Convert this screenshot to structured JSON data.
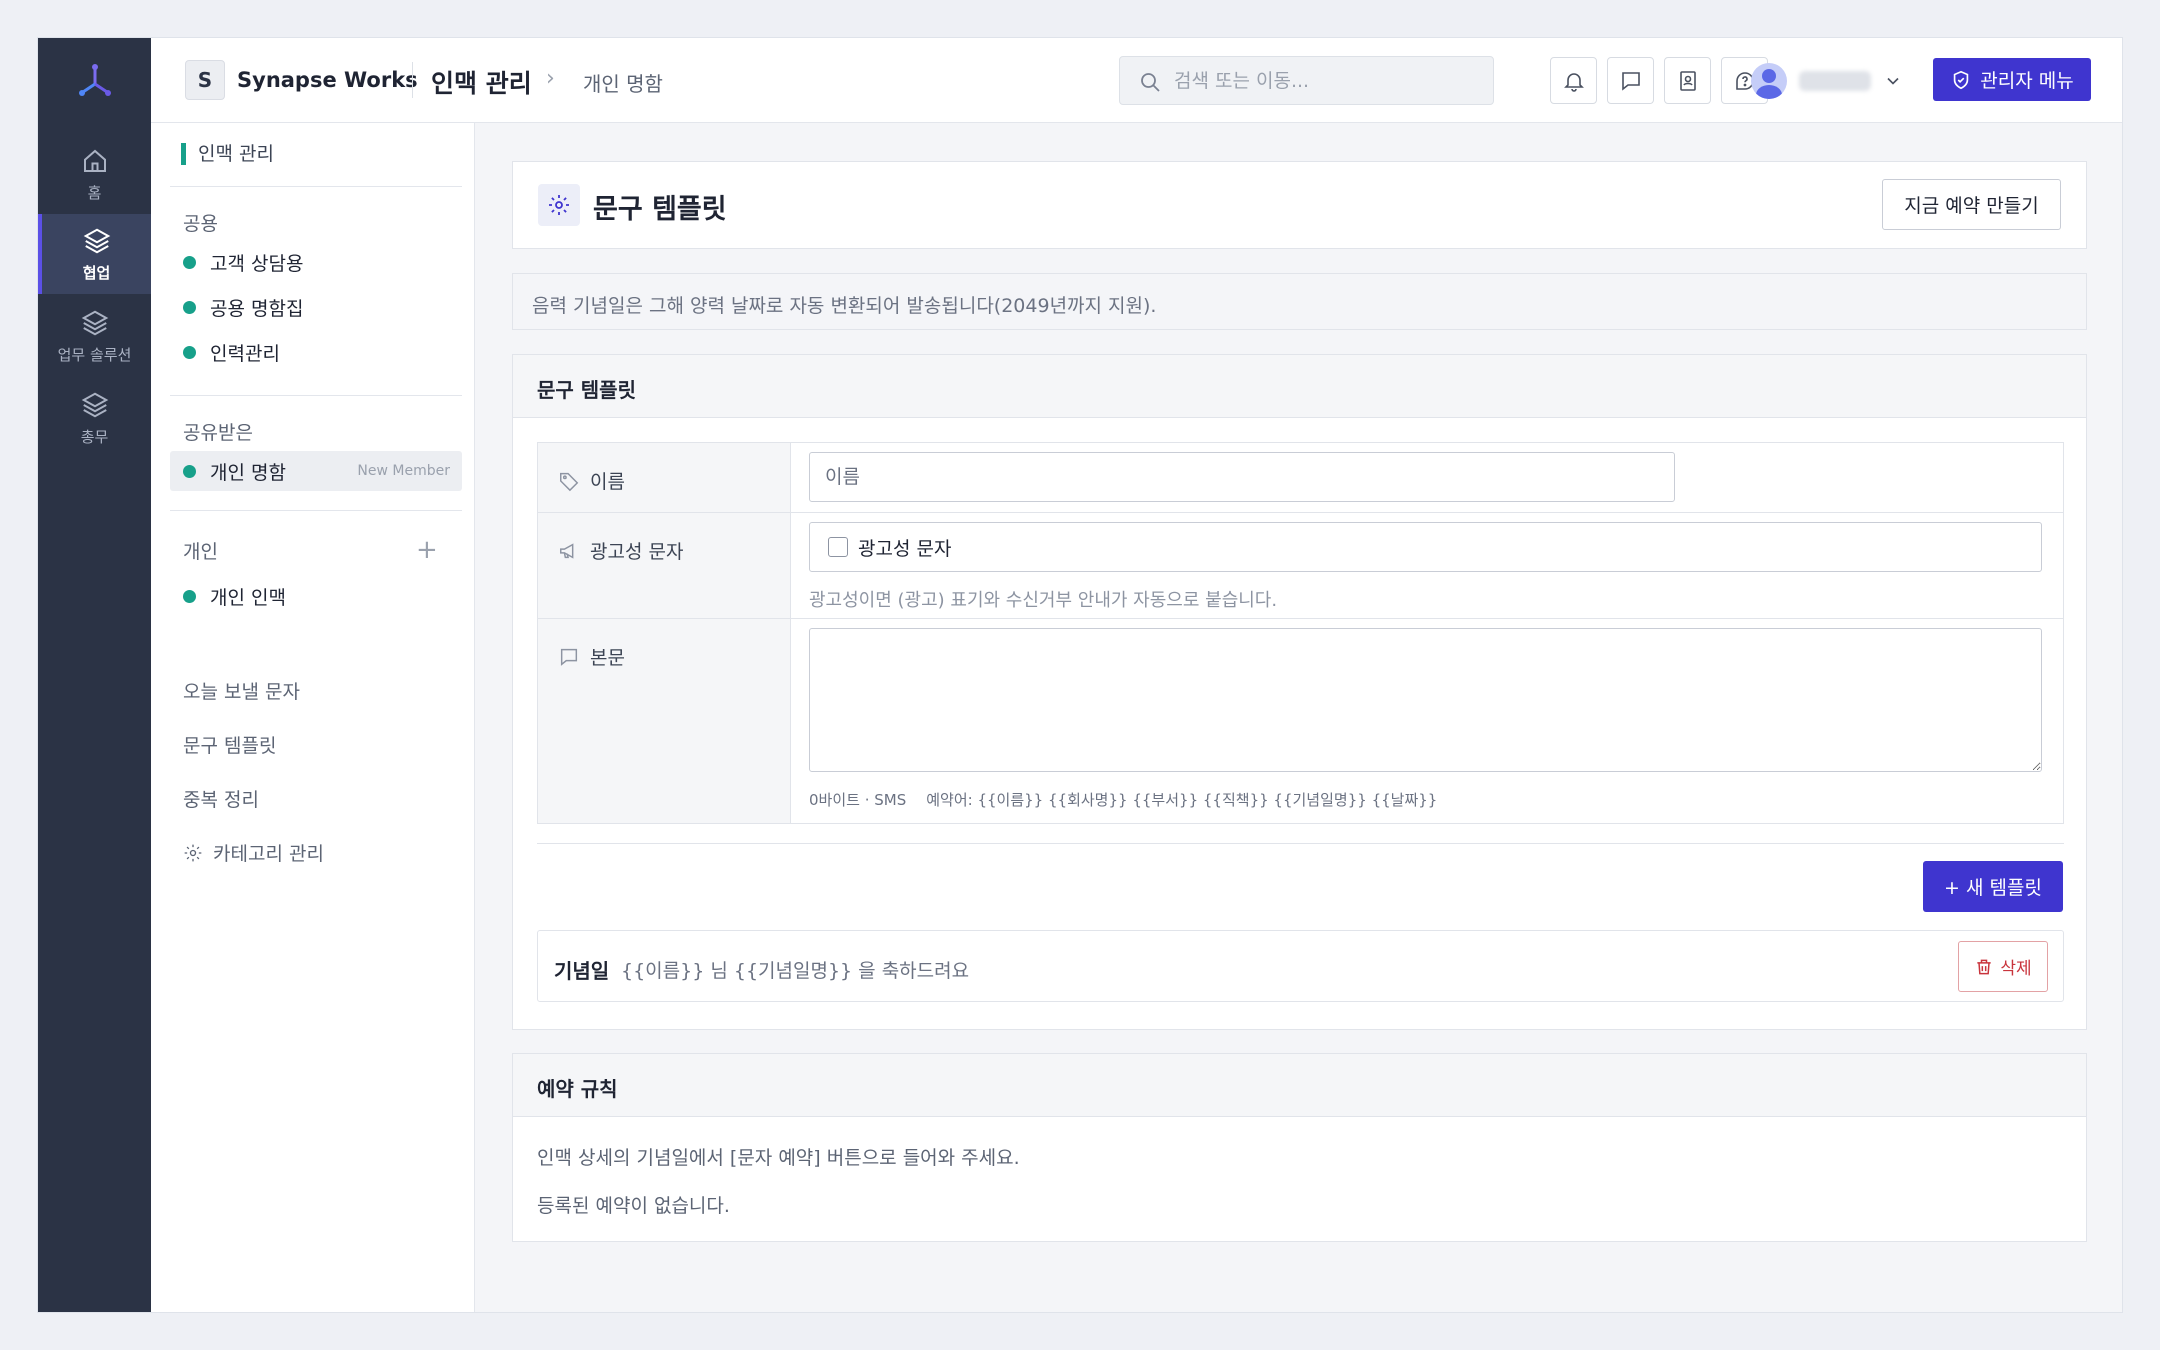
{
  "rail": {
    "items": [
      {
        "label": "홈",
        "icon": "home-icon"
      },
      {
        "label": "협업",
        "icon": "layers-icon",
        "active": true
      },
      {
        "label": "업무 솔루션",
        "icon": "layers-icon"
      },
      {
        "label": "총무",
        "icon": "layers-icon"
      }
    ]
  },
  "topbar": {
    "org_initial": "S",
    "org_name": "Synapse Works",
    "title": "인맥 관리",
    "breadcrumb": "개인 명함",
    "search_placeholder": "검색 또는 이동...",
    "admin_label": "관리자 메뉴"
  },
  "sidebar": {
    "header": "인맥 관리",
    "group_public": "공용",
    "public_items": [
      "고객 상담용",
      "공용 명함집",
      "인력관리"
    ],
    "group_shared": "공유받은",
    "shared_item": "개인 명함",
    "shared_tag": "New Member",
    "group_personal": "개인",
    "personal_plus": "+",
    "personal_item": "개인 인맥",
    "links": [
      "오늘 보낼 문자",
      "문구 템플릿",
      "중복 정리"
    ],
    "category": "카테고리 관리"
  },
  "page": {
    "title": "문구 템플릿",
    "create_button": "지금 예약 만들기",
    "notice": "음력 기념일은 그해 양력 날짜로 자동 변환되어 발송됩니다(2049년까지 지원)."
  },
  "template_section": {
    "title": "문구 템플릿",
    "name_label": "이름",
    "name_placeholder": "이름",
    "ad_label": "광고성 문자",
    "ad_checkbox": "광고성 문자",
    "ad_hint": "광고성이면 (광고) 표기와 수신거부 안내가 자동으로 붙습니다.",
    "body_label": "본문",
    "body_value": "",
    "byte_info": "0바이트 · SMS",
    "example": "예약어: {{이름}} {{회사명}} {{부서}} {{직책}} {{기념일명}} {{날짜}}",
    "new_button": "+ 새 템플릿",
    "items": [
      {
        "name": "기념일",
        "body": "{{이름}} 님 {{기념일명}} 을 축하드려요",
        "delete_label": "삭제"
      }
    ]
  },
  "rule_section": {
    "title": "예약 규칙",
    "guide": "인맥 상세의 기념일에서 [문자 예약] 버튼으로 들어와 주세요.",
    "empty": "등록된 예약이 없습니다."
  },
  "colors": {
    "rail_bg": "#2b3345",
    "accent": "#3f35cf",
    "dot": "#17a08a",
    "danger": "#c9343c"
  }
}
